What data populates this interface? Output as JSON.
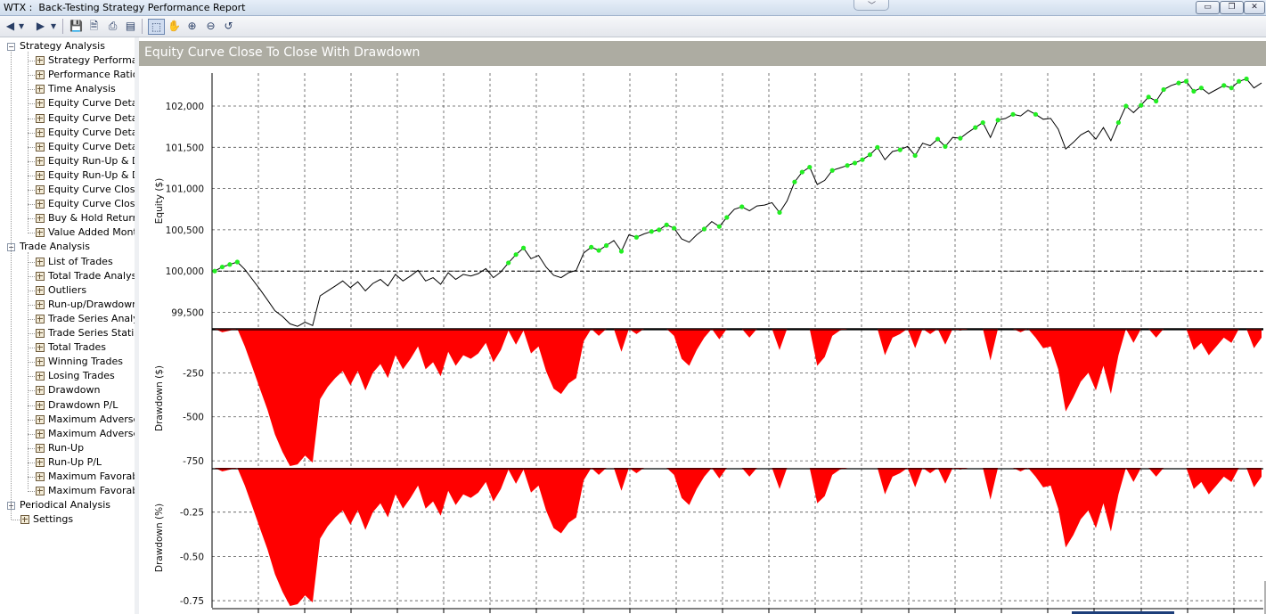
{
  "window": {
    "title": "WTX :  Back-Testing Strategy Performance Report",
    "controls": {
      "minimize": "▭",
      "restore": "❐",
      "close": "✕"
    }
  },
  "toolbar": {
    "buttons": [
      {
        "name": "back-button",
        "glyph": "◀"
      },
      {
        "name": "back-dropdown",
        "glyph": "▾"
      },
      {
        "name": "forward-button",
        "glyph": "▶"
      },
      {
        "name": "forward-dropdown",
        "glyph": "▾"
      },
      {
        "name": "save-button",
        "glyph": "💾"
      },
      {
        "name": "print-preview-button",
        "glyph": "🗎"
      },
      {
        "name": "print-button",
        "glyph": "⎙"
      },
      {
        "name": "view-options-button",
        "glyph": "▤"
      },
      {
        "name": "select-tool-button",
        "glyph": "⬚"
      },
      {
        "name": "pan-tool-button",
        "glyph": "✋"
      },
      {
        "name": "zoom-in-button",
        "glyph": "⊕"
      },
      {
        "name": "zoom-out-button",
        "glyph": "⊖"
      },
      {
        "name": "reset-zoom-button",
        "glyph": "↺"
      }
    ]
  },
  "sidebar": {
    "groups": [
      {
        "label": "Strategy Analysis",
        "expanded": true,
        "items": [
          "Strategy Performar",
          "Performance Ratios",
          "Time Analysis",
          "Equity Curve Detail",
          "Equity Curve Detail",
          "Equity Curve Detail",
          "Equity Curve Detail",
          "Equity Run-Up & D",
          "Equity Run-Up & D",
          "Equity Curve Close",
          "Equity Curve Close",
          "Buy & Hold Return",
          "Value Added Mont"
        ]
      },
      {
        "label": "Trade Analysis",
        "expanded": true,
        "items": [
          "List of Trades",
          "Total Trade Analysi",
          "Outliers",
          "Run-up/Drawdown",
          "Trade Series Analys",
          "Trade Series Statist",
          "Total Trades",
          "Winning Trades",
          "Losing Trades",
          "Drawdown",
          "Drawdown P/L",
          "Maximum Adverse",
          "Maximum Adverse",
          "Run-Up",
          "Run-Up P/L",
          "Maximum Favorab",
          "Maximum Favorab"
        ]
      },
      {
        "label": "Periodical Analysis",
        "expanded": false,
        "items": []
      }
    ],
    "settings_label": "Settings"
  },
  "report": {
    "title": "Equity Curve Close To Close With Drawdown"
  },
  "chart_data": [
    {
      "type": "line",
      "ylabel": "Equity ($)",
      "ylim": [
        99300,
        102400
      ],
      "yticks": [
        "102,000",
        "101,500",
        "101,000",
        "100,500",
        "100,000",
        "99,500"
      ],
      "ytick_values": [
        102000,
        101500,
        101000,
        100500,
        100000,
        99500
      ],
      "reference_line": 100000,
      "grid": true,
      "line_color": "#000000",
      "marker_color": "#22ee22",
      "series": [
        {
          "values": [
            100000,
            100050,
            100080,
            100110,
            100020,
            99900,
            99780,
            99650,
            99520,
            99450,
            99360,
            99330,
            99380,
            99340,
            99700,
            99760,
            99820,
            99880,
            99800,
            99870,
            99760,
            99850,
            99900,
            99820,
            99960,
            99880,
            99940,
            100010,
            99880,
            99920,
            99840,
            99980,
            99900,
            99960,
            99940,
            99970,
            100030,
            99920,
            99990,
            100100,
            100200,
            100280,
            100150,
            100190,
            100050,
            99950,
            99920,
            99980,
            100010,
            100220,
            100290,
            100250,
            100310,
            100370,
            100240,
            100440,
            100410,
            100450,
            100480,
            100500,
            100560,
            100520,
            100390,
            100350,
            100440,
            100510,
            100600,
            100540,
            100650,
            100750,
            100780,
            100730,
            100790,
            100800,
            100830,
            100710,
            100850,
            101080,
            101200,
            101260,
            101050,
            101100,
            101220,
            101250,
            101280,
            101310,
            101350,
            101410,
            101500,
            101350,
            101450,
            101470,
            101510,
            101400,
            101550,
            101520,
            101600,
            101510,
            101620,
            101610,
            101680,
            101740,
            101800,
            101620,
            101830,
            101850,
            101900,
            101880,
            101950,
            101900,
            101840,
            101850,
            101720,
            101480,
            101560,
            101650,
            101700,
            101600,
            101740,
            101580,
            101800,
            102000,
            101920,
            102010,
            102110,
            102060,
            102200,
            102250,
            102280,
            102300,
            102180,
            102220,
            102150,
            102200,
            102250,
            102220,
            102300,
            102330,
            102220,
            102280
          ]
        }
      ],
      "markers_at": [
        0,
        1,
        2,
        3,
        39,
        40,
        41,
        50,
        51,
        52,
        54,
        56,
        58,
        59,
        60,
        61,
        65,
        67,
        68,
        70,
        75,
        77,
        78,
        79,
        82,
        84,
        85,
        86,
        87,
        88,
        91,
        93,
        96,
        97,
        99,
        101,
        102,
        104,
        106,
        109,
        120,
        121,
        123,
        124,
        125,
        126,
        128,
        129,
        130,
        131,
        134,
        135,
        136,
        137
      ]
    },
    {
      "type": "area",
      "ylabel": "Drawdown ($)",
      "ylim": [
        -790,
        0
      ],
      "yticks": [
        "-250",
        "-500",
        "-750"
      ],
      "ytick_values": [
        -250,
        -500,
        -750
      ],
      "fill_color": "#ff0000",
      "grid": true,
      "series": [
        {
          "values": [
            0,
            -20,
            -10,
            0,
            -100,
            -220,
            -340,
            -460,
            -600,
            -700,
            -780,
            -770,
            -720,
            -760,
            -400,
            -330,
            -280,
            -240,
            -320,
            -240,
            -350,
            -250,
            -200,
            -280,
            -150,
            -230,
            -170,
            -100,
            -230,
            -190,
            -270,
            -130,
            -210,
            -150,
            -170,
            -140,
            -80,
            -190,
            -120,
            -10,
            -90,
            -10,
            -140,
            -100,
            -240,
            -340,
            -370,
            -310,
            -280,
            -70,
            0,
            -40,
            0,
            0,
            -130,
            0,
            -30,
            0,
            0,
            0,
            0,
            -40,
            -170,
            -210,
            -120,
            -50,
            0,
            -60,
            0,
            0,
            0,
            -50,
            0,
            0,
            0,
            -120,
            0,
            0,
            0,
            0,
            -210,
            -160,
            -40,
            -10,
            0,
            0,
            0,
            0,
            0,
            -150,
            -50,
            -30,
            0,
            -110,
            0,
            -30,
            0,
            -90,
            0,
            -10,
            0,
            0,
            0,
            -180,
            0,
            0,
            0,
            -20,
            0,
            -50,
            -110,
            -100,
            -230,
            -470,
            -390,
            -300,
            -250,
            -350,
            -210,
            -370,
            -150,
            0,
            -80,
            0,
            0,
            -50,
            0,
            0,
            0,
            0,
            -120,
            -80,
            -150,
            -100,
            -50,
            -80,
            0,
            0,
            -110,
            -50
          ]
        }
      ]
    },
    {
      "type": "area",
      "ylabel": "Drawdown (%)",
      "ylim": [
        -0.79,
        0
      ],
      "yticks": [
        "-0.25",
        "-0.50",
        "-0.75"
      ],
      "ytick_values": [
        -0.25,
        -0.5,
        -0.75
      ],
      "fill_color": "#ff0000",
      "grid": true,
      "series": [
        {
          "values": [
            0,
            -0.02,
            -0.01,
            0,
            -0.1,
            -0.22,
            -0.34,
            -0.46,
            -0.6,
            -0.7,
            -0.78,
            -0.77,
            -0.72,
            -0.76,
            -0.4,
            -0.33,
            -0.28,
            -0.24,
            -0.32,
            -0.24,
            -0.35,
            -0.25,
            -0.2,
            -0.28,
            -0.15,
            -0.23,
            -0.17,
            -0.1,
            -0.23,
            -0.19,
            -0.27,
            -0.13,
            -0.21,
            -0.15,
            -0.17,
            -0.14,
            -0.08,
            -0.19,
            -0.12,
            -0.01,
            -0.09,
            -0.01,
            -0.14,
            -0.1,
            -0.24,
            -0.34,
            -0.37,
            -0.31,
            -0.28,
            -0.07,
            0,
            -0.04,
            0,
            0,
            -0.13,
            0,
            -0.03,
            0,
            0,
            0,
            0,
            -0.04,
            -0.17,
            -0.21,
            -0.12,
            -0.05,
            0,
            -0.06,
            0,
            0,
            0,
            -0.05,
            0,
            0,
            0,
            -0.12,
            0,
            0,
            0,
            0,
            -0.2,
            -0.16,
            -0.04,
            -0.01,
            0,
            0,
            0,
            0,
            0,
            -0.15,
            -0.05,
            -0.03,
            0,
            -0.11,
            0,
            -0.03,
            0,
            -0.09,
            0,
            -0.01,
            0,
            0,
            0,
            -0.18,
            0,
            0,
            0,
            -0.02,
            0,
            -0.05,
            -0.11,
            -0.1,
            -0.23,
            -0.45,
            -0.38,
            -0.29,
            -0.24,
            -0.34,
            -0.2,
            -0.36,
            -0.15,
            0,
            -0.08,
            0,
            0,
            -0.05,
            0,
            0,
            0,
            0,
            -0.12,
            -0.08,
            -0.15,
            -0.1,
            -0.05,
            -0.08,
            0,
            0,
            -0.11,
            -0.05
          ]
        }
      ]
    }
  ]
}
